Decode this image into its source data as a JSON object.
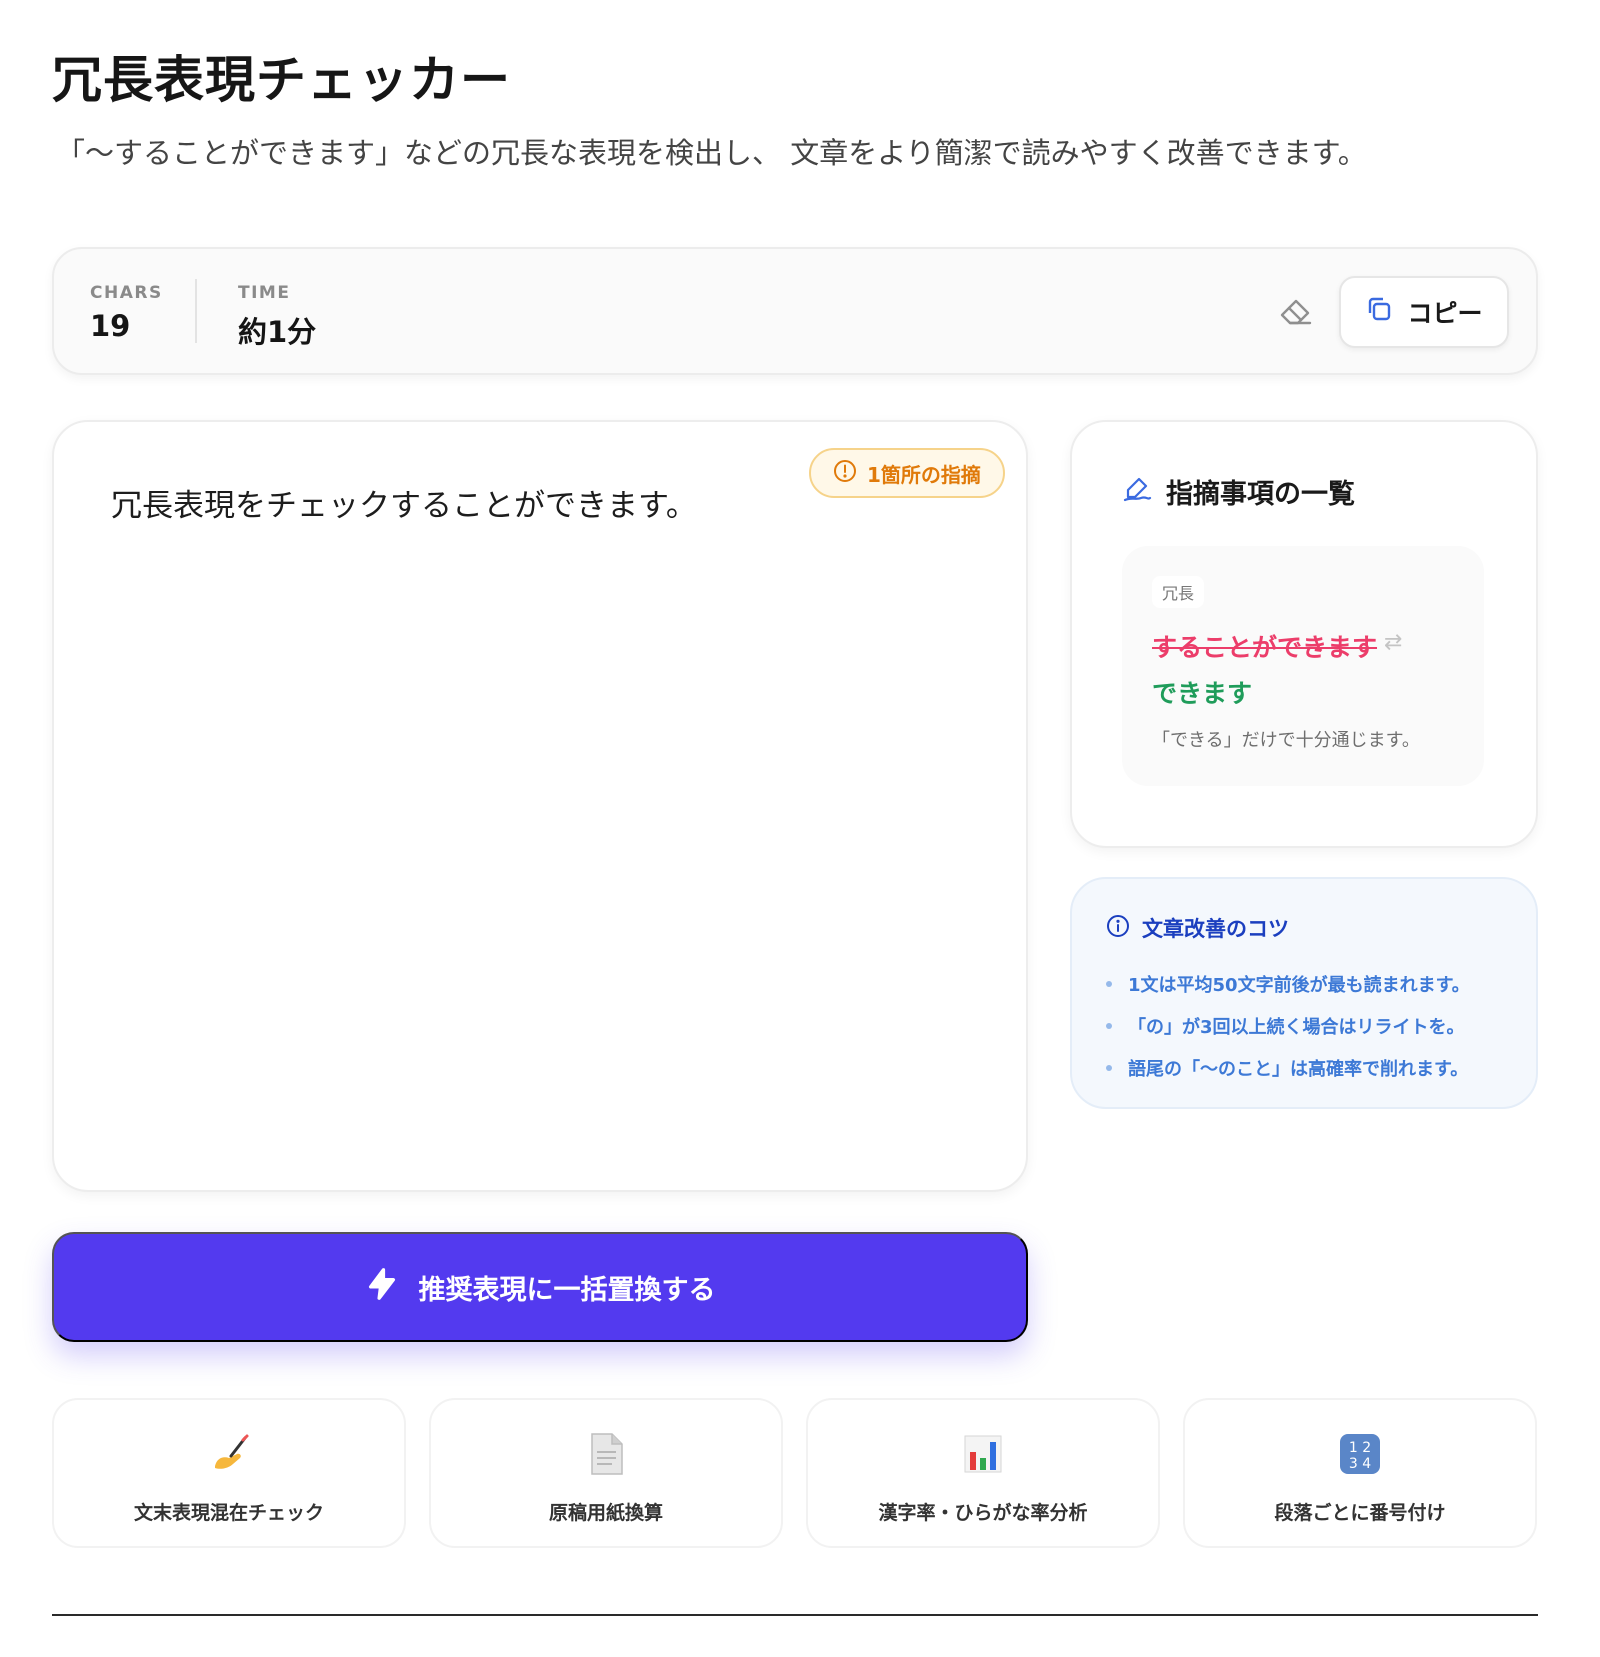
{
  "header": {
    "title": "冗長表現チェッカー",
    "subtitle": "「〜することができます」などの冗長な表現を検出し、 文章をより簡潔で読みやすく改善できます。"
  },
  "stats": {
    "chars_label": "CHARS",
    "chars_value": "19",
    "time_label": "TIME",
    "time_value": "約1分",
    "clear_icon": "eraser-icon",
    "copy_icon": "copy-icon",
    "copy_label": "コピー"
  },
  "editor": {
    "text": "冗長表現をチェックすることができます。",
    "badge_icon": "alert-circle-icon",
    "badge_label": "1箇所の指摘"
  },
  "results": {
    "icon": "pen-icon",
    "title": "指摘事項の一覧",
    "items": [
      {
        "tag": "冗長",
        "original": "することができます",
        "swap_icon": "swap-arrows-icon",
        "suggestion": "できます",
        "note": "「できる」だけで十分通じます。"
      }
    ]
  },
  "tips": {
    "icon": "info-icon",
    "title": "文章改善のコツ",
    "items": [
      "1文は平均50文字前後が最も読まれます。",
      "「の」が3回以上続く場合はリライトを。",
      "語尾の「〜のこと」は高確率で削れます。"
    ]
  },
  "action": {
    "icon": "lightning-icon",
    "label": "推奨表現に一括置換する"
  },
  "tools": [
    {
      "icon": "writing-hand-icon",
      "label": "文末表現混在チェック"
    },
    {
      "icon": "document-icon",
      "label": "原稿用紙換算"
    },
    {
      "icon": "bar-chart-icon",
      "label": "漢字率・ひらがな率分析"
    },
    {
      "icon": "number-keycap-icon",
      "label": "段落ごとに番号付け"
    }
  ],
  "colors": {
    "accent": "#533aef",
    "removed": "#ec3d6a",
    "added": "#1f9c5a",
    "warning": "#e07a0a",
    "tip": "#3d79d6"
  }
}
